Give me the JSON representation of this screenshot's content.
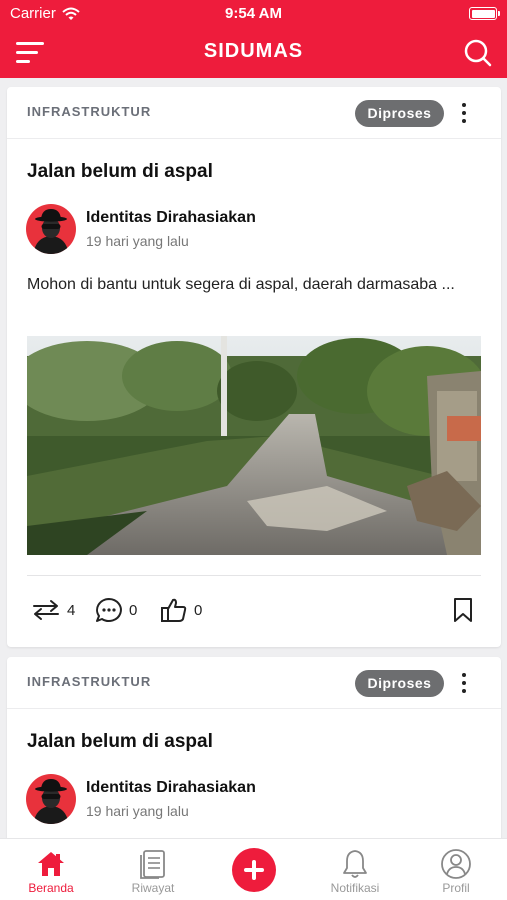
{
  "status": {
    "carrier": "Carrier",
    "time": "9:54 AM"
  },
  "app": {
    "title": "SIDUMAS"
  },
  "posts": [
    {
      "category": "INFRASTRUKTUR",
      "status": "Diproses",
      "title": "Jalan belum di aspal",
      "author": "Identitas Dirahasiakan",
      "time": "19 hari yang lalu",
      "description": "Mohon di bantu untuk segera di aspal, daerah darmasaba ...",
      "reposts": "4",
      "comments": "0",
      "likes": "0"
    },
    {
      "category": "INFRASTRUKTUR",
      "status": "Diproses",
      "title": "Jalan belum di aspal",
      "author": "Identitas Dirahasiakan",
      "time": "19 hari yang lalu"
    }
  ],
  "tabs": {
    "home": "Beranda",
    "history": "Riwayat",
    "notifications": "Notifikasi",
    "profile": "Profil"
  },
  "colors": {
    "accent": "#ee1c3c",
    "badge": "#6d6e70"
  }
}
